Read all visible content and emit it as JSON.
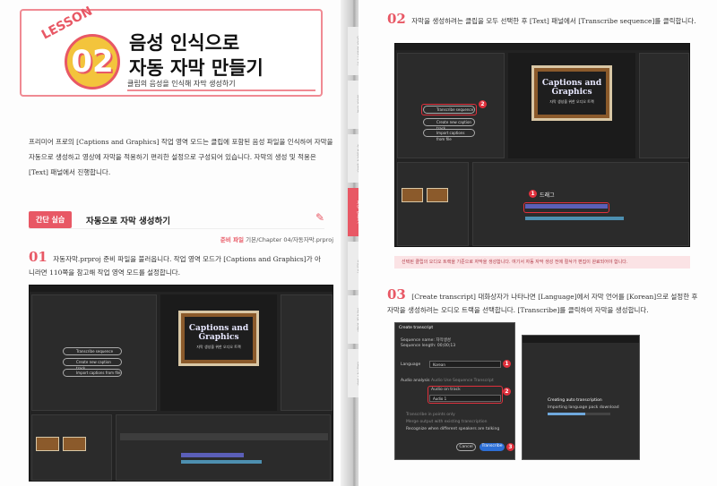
{
  "lesson": {
    "label": "LESSON",
    "number": "02",
    "title_line1": "음성 인식으로",
    "title_line2": "자동 자막 만들기",
    "subtitle": "클립의 음성을 인식해 자막 생성하기"
  },
  "intro": "프리미어 프로의 [Captions and Graphics] 작업 영역 모드는 클립에 포함된 음성 파일을 인식하여 자막을 자동으로 생성하고 영상에 자막을 적용하기 편리한 설정으로 구성되어 있습니다. 자막의 생성 및 적용은 [Text] 패널에서 진행합니다.",
  "section": {
    "tag": "간단 실습",
    "title": "자동으로 자막 생성하기"
  },
  "prep": {
    "label": "준비 파일",
    "path": "기본/Chapter 04/자동자막.prproj"
  },
  "steps": [
    {
      "num": "01",
      "text": "자동자막.prproj 준비 파일을 불러옵니다. 작업 영역 모드가 [Captions and Graphics]가 아니라면 110쪽을 참고해 작업 영역 모드를 설정합니다."
    },
    {
      "num": "02",
      "text": "자막을 생성하려는 클립을 모두 선택한 후 [Text] 패널에서 [Transcribe sequence]를 클릭합니다."
    },
    {
      "num": "03",
      "text": "[Create transcript] 대화상자가 나타나면 [Language]에서 자막 언어를 [Korean]으로 설정한 후 자막을 생성하려는 오디오 트랙을 선택합니다. [Transcribe]를 클릭하여 자막을 생성합니다."
    }
  ],
  "note": "선택된 클립의 오디오 트랙을 기준으로 자막을 생성합니다. 여기서 자동 자막 생성 전에 절삭가 편집이 완료되어야 합니다.",
  "side_tabs": [
    "영상 편집 기초",
    "편집 실무",
    "색보정과 합성",
    "자막 만들기",
    "오디오",
    "효과와 전환",
    "출력과 공유"
  ],
  "screens": {
    "caption_title": "Captions and Graphics",
    "caption_sub": "자막 생성을 위한 오디오 트랙",
    "transcribe": "Transcribe sequence",
    "create_caption": "Create new caption track",
    "import_caption": "Import captions from file",
    "drag_label": "드래그",
    "dialog_title": "Create transcript",
    "seq_name": "Sequence name: 자막생성",
    "seq_len": "Sequence length: 00;00;13",
    "language_label": "Language",
    "language_value": "Korean",
    "audio_label": "Audio analysis",
    "audio_opt1": "Audio Use Sequence Transcript",
    "audio_opt2": "Audio on track",
    "audio_track": "Audio 1",
    "cb1": "Transcribe in points only",
    "cb2": "Merge output with existing transcription",
    "cb3": "Recognize when different speakers are talking",
    "cancel": "Cancel",
    "transcribe_btn": "Transcribe",
    "creating": "Creating auto transcription",
    "progress_text": "Importing language pack download",
    "progress": 0.6
  }
}
